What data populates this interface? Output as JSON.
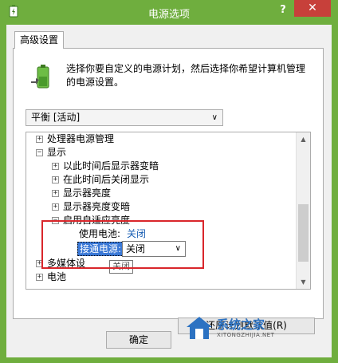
{
  "window": {
    "title": "电源选项",
    "help": "?",
    "close": "✕"
  },
  "tabs": {
    "advanced": "高级设置"
  },
  "description": "选择你要自定义的电源计划，然后选择你希望计算机管理的电源设置。",
  "plan_select": {
    "value": "平衡 [活动]"
  },
  "tree": {
    "items": {
      "processor": "处理器电源管理",
      "display": "显示",
      "dim_after": "以此时间后显示器变暗",
      "off_after": "在此时间后关闭显示",
      "brightness": "显示器亮度",
      "dimmed_brightness": "显示器亮度变暗",
      "adaptive": "启用自适应亮度",
      "on_battery_label": "使用电池:",
      "on_battery_value": "关闭",
      "plugged_in_label": "接通电源:",
      "plugged_in_value": "关闭",
      "multimedia": "多媒体设",
      "battery": "电池"
    },
    "tooltip": "关闭"
  },
  "buttons": {
    "restore": "还原计划默认值(R)",
    "ok": "确定"
  },
  "watermark": {
    "title": "系统之家",
    "sub": "XITONGZHIJIA.NET"
  }
}
